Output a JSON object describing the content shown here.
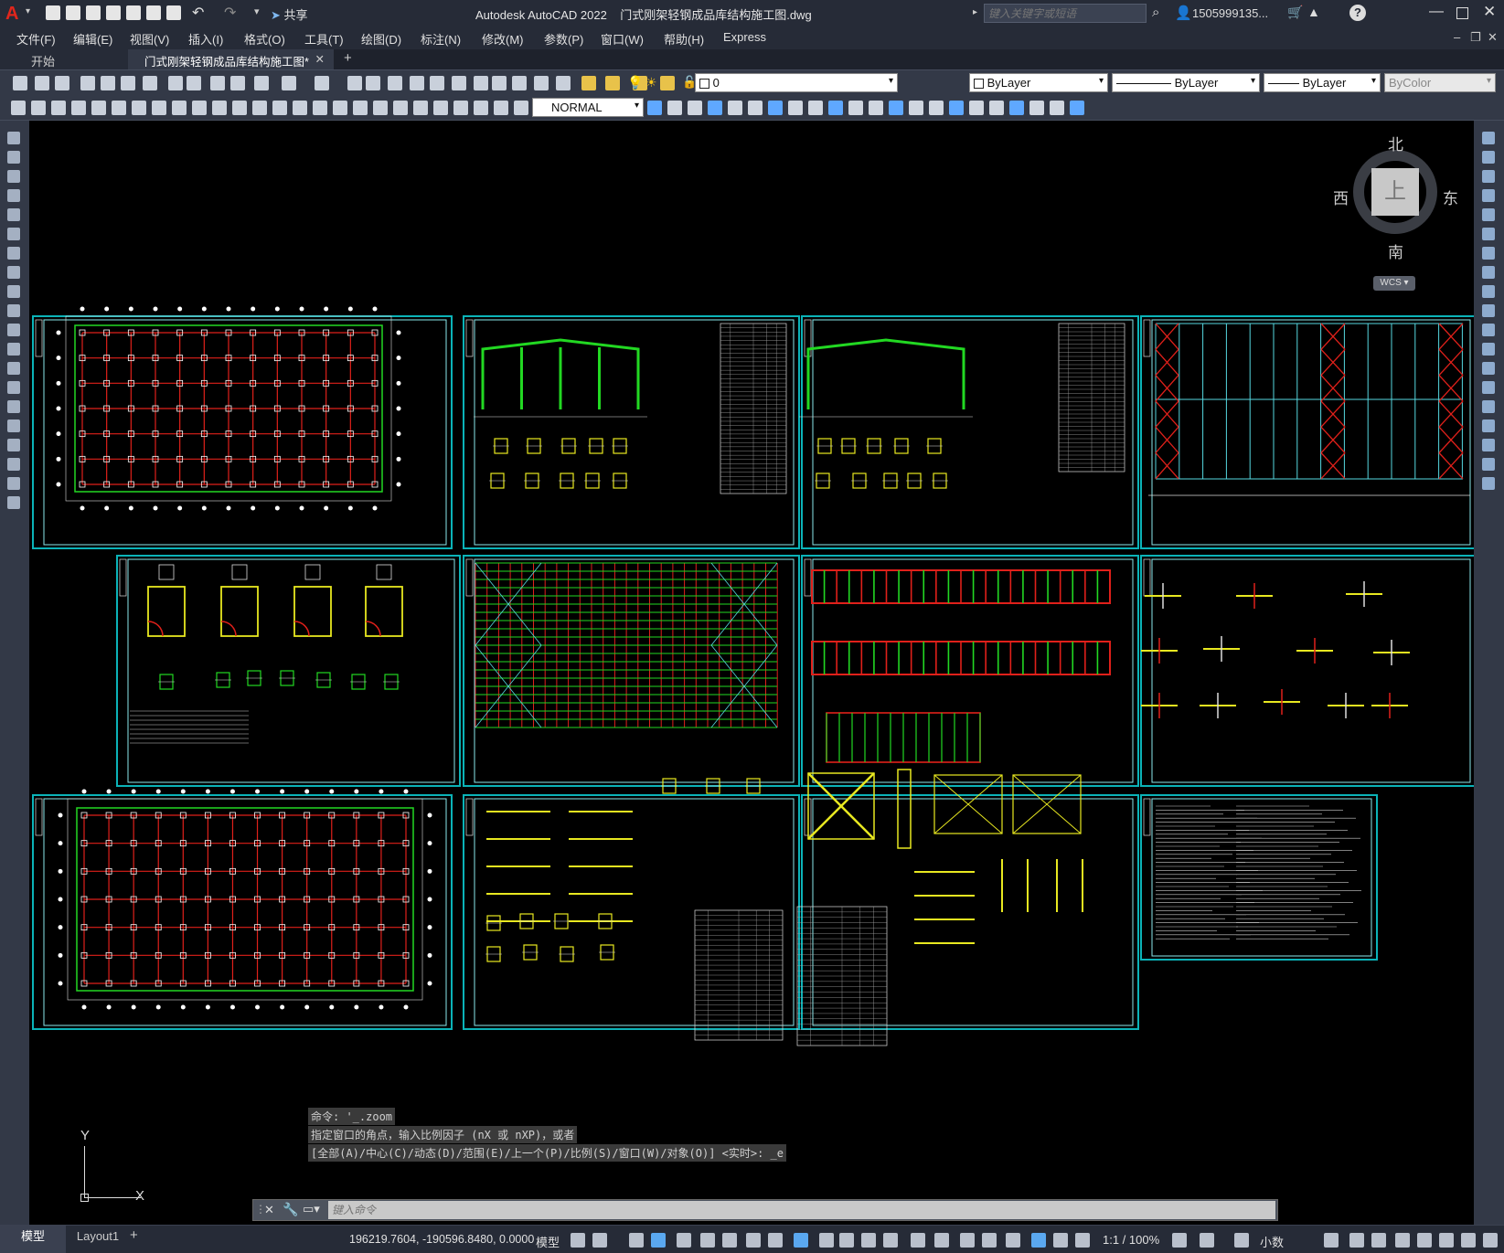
{
  "app": {
    "title": "Autodesk AutoCAD 2022",
    "filename": "门式刚架轻钢成品库结构施工图.dwg",
    "share_label": "共享",
    "search_placeholder": "键入关键字或短语",
    "user": "1505999135...",
    "help": "?"
  },
  "menu": [
    "文件(F)",
    "编辑(E)",
    "视图(V)",
    "插入(I)",
    "格式(O)",
    "工具(T)",
    "绘图(D)",
    "标注(N)",
    "修改(M)",
    "参数(P)",
    "窗口(W)",
    "帮助(H)",
    "Express"
  ],
  "tabs": {
    "start": "开始",
    "active": "门式刚架轻钢成品库结构施工图*",
    "add": "+"
  },
  "toolbar": {
    "layer_value": "0",
    "textstyle_value": "NORMAL",
    "color_value": "ByLayer",
    "linetype_value": "ByLayer",
    "lineweight_value": "ByLayer",
    "plotstyle_value": "ByColor"
  },
  "viewcube": {
    "north": "北",
    "south": "南",
    "east": "东",
    "west": "西",
    "top": "上",
    "wcs": "WCS"
  },
  "ucs": {
    "y": "Y",
    "x": "X"
  },
  "command": {
    "history": [
      "命令: '_.zoom",
      "指定窗口的角点，输入比例因子 (nX 或 nXP)，或者",
      "[全部(A)/中心(C)/动态(D)/范围(E)/上一个(P)/比例(S)/窗口(W)/对象(O)] <实时>: _e"
    ],
    "placeholder": "键入命令"
  },
  "status": {
    "model_tab": "模型",
    "layout_tab": "Layout1",
    "add_layout": "+",
    "coords": "196219.7604, -190596.8480, 0.0000",
    "space": "模型",
    "scale": "1:1 / 100%",
    "units": "小数"
  },
  "colors": {
    "frame": "#0bb3b8",
    "grid_red": "#e0201a",
    "green": "#22d822",
    "yellow": "#e8e820",
    "bg": "#000000"
  }
}
